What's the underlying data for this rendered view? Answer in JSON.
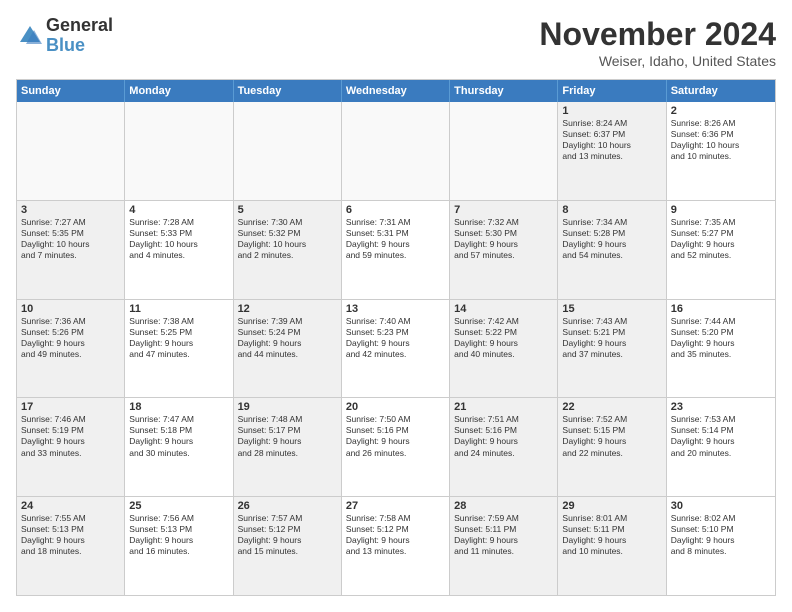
{
  "logo": {
    "general": "General",
    "blue": "Blue"
  },
  "title": "November 2024",
  "location": "Weiser, Idaho, United States",
  "headers": [
    "Sunday",
    "Monday",
    "Tuesday",
    "Wednesday",
    "Thursday",
    "Friday",
    "Saturday"
  ],
  "rows": [
    [
      {
        "day": "",
        "text": "",
        "empty": true
      },
      {
        "day": "",
        "text": "",
        "empty": true
      },
      {
        "day": "",
        "text": "",
        "empty": true
      },
      {
        "day": "",
        "text": "",
        "empty": true
      },
      {
        "day": "",
        "text": "",
        "empty": true
      },
      {
        "day": "1",
        "text": "Sunrise: 8:24 AM\nSunset: 6:37 PM\nDaylight: 10 hours\nand 13 minutes.",
        "shaded": true
      },
      {
        "day": "2",
        "text": "Sunrise: 8:26 AM\nSunset: 6:36 PM\nDaylight: 10 hours\nand 10 minutes."
      }
    ],
    [
      {
        "day": "3",
        "text": "Sunrise: 7:27 AM\nSunset: 5:35 PM\nDaylight: 10 hours\nand 7 minutes.",
        "shaded": true
      },
      {
        "day": "4",
        "text": "Sunrise: 7:28 AM\nSunset: 5:33 PM\nDaylight: 10 hours\nand 4 minutes."
      },
      {
        "day": "5",
        "text": "Sunrise: 7:30 AM\nSunset: 5:32 PM\nDaylight: 10 hours\nand 2 minutes.",
        "shaded": true
      },
      {
        "day": "6",
        "text": "Sunrise: 7:31 AM\nSunset: 5:31 PM\nDaylight: 9 hours\nand 59 minutes."
      },
      {
        "day": "7",
        "text": "Sunrise: 7:32 AM\nSunset: 5:30 PM\nDaylight: 9 hours\nand 57 minutes.",
        "shaded": true
      },
      {
        "day": "8",
        "text": "Sunrise: 7:34 AM\nSunset: 5:28 PM\nDaylight: 9 hours\nand 54 minutes.",
        "shaded": true
      },
      {
        "day": "9",
        "text": "Sunrise: 7:35 AM\nSunset: 5:27 PM\nDaylight: 9 hours\nand 52 minutes."
      }
    ],
    [
      {
        "day": "10",
        "text": "Sunrise: 7:36 AM\nSunset: 5:26 PM\nDaylight: 9 hours\nand 49 minutes.",
        "shaded": true
      },
      {
        "day": "11",
        "text": "Sunrise: 7:38 AM\nSunset: 5:25 PM\nDaylight: 9 hours\nand 47 minutes."
      },
      {
        "day": "12",
        "text": "Sunrise: 7:39 AM\nSunset: 5:24 PM\nDaylight: 9 hours\nand 44 minutes.",
        "shaded": true
      },
      {
        "day": "13",
        "text": "Sunrise: 7:40 AM\nSunset: 5:23 PM\nDaylight: 9 hours\nand 42 minutes."
      },
      {
        "day": "14",
        "text": "Sunrise: 7:42 AM\nSunset: 5:22 PM\nDaylight: 9 hours\nand 40 minutes.",
        "shaded": true
      },
      {
        "day": "15",
        "text": "Sunrise: 7:43 AM\nSunset: 5:21 PM\nDaylight: 9 hours\nand 37 minutes.",
        "shaded": true
      },
      {
        "day": "16",
        "text": "Sunrise: 7:44 AM\nSunset: 5:20 PM\nDaylight: 9 hours\nand 35 minutes."
      }
    ],
    [
      {
        "day": "17",
        "text": "Sunrise: 7:46 AM\nSunset: 5:19 PM\nDaylight: 9 hours\nand 33 minutes.",
        "shaded": true
      },
      {
        "day": "18",
        "text": "Sunrise: 7:47 AM\nSunset: 5:18 PM\nDaylight: 9 hours\nand 30 minutes."
      },
      {
        "day": "19",
        "text": "Sunrise: 7:48 AM\nSunset: 5:17 PM\nDaylight: 9 hours\nand 28 minutes.",
        "shaded": true
      },
      {
        "day": "20",
        "text": "Sunrise: 7:50 AM\nSunset: 5:16 PM\nDaylight: 9 hours\nand 26 minutes."
      },
      {
        "day": "21",
        "text": "Sunrise: 7:51 AM\nSunset: 5:16 PM\nDaylight: 9 hours\nand 24 minutes.",
        "shaded": true
      },
      {
        "day": "22",
        "text": "Sunrise: 7:52 AM\nSunset: 5:15 PM\nDaylight: 9 hours\nand 22 minutes.",
        "shaded": true
      },
      {
        "day": "23",
        "text": "Sunrise: 7:53 AM\nSunset: 5:14 PM\nDaylight: 9 hours\nand 20 minutes."
      }
    ],
    [
      {
        "day": "24",
        "text": "Sunrise: 7:55 AM\nSunset: 5:13 PM\nDaylight: 9 hours\nand 18 minutes.",
        "shaded": true
      },
      {
        "day": "25",
        "text": "Sunrise: 7:56 AM\nSunset: 5:13 PM\nDaylight: 9 hours\nand 16 minutes."
      },
      {
        "day": "26",
        "text": "Sunrise: 7:57 AM\nSunset: 5:12 PM\nDaylight: 9 hours\nand 15 minutes.",
        "shaded": true
      },
      {
        "day": "27",
        "text": "Sunrise: 7:58 AM\nSunset: 5:12 PM\nDaylight: 9 hours\nand 13 minutes."
      },
      {
        "day": "28",
        "text": "Sunrise: 7:59 AM\nSunset: 5:11 PM\nDaylight: 9 hours\nand 11 minutes.",
        "shaded": true
      },
      {
        "day": "29",
        "text": "Sunrise: 8:01 AM\nSunset: 5:11 PM\nDaylight: 9 hours\nand 10 minutes.",
        "shaded": true
      },
      {
        "day": "30",
        "text": "Sunrise: 8:02 AM\nSunset: 5:10 PM\nDaylight: 9 hours\nand 8 minutes."
      }
    ]
  ]
}
